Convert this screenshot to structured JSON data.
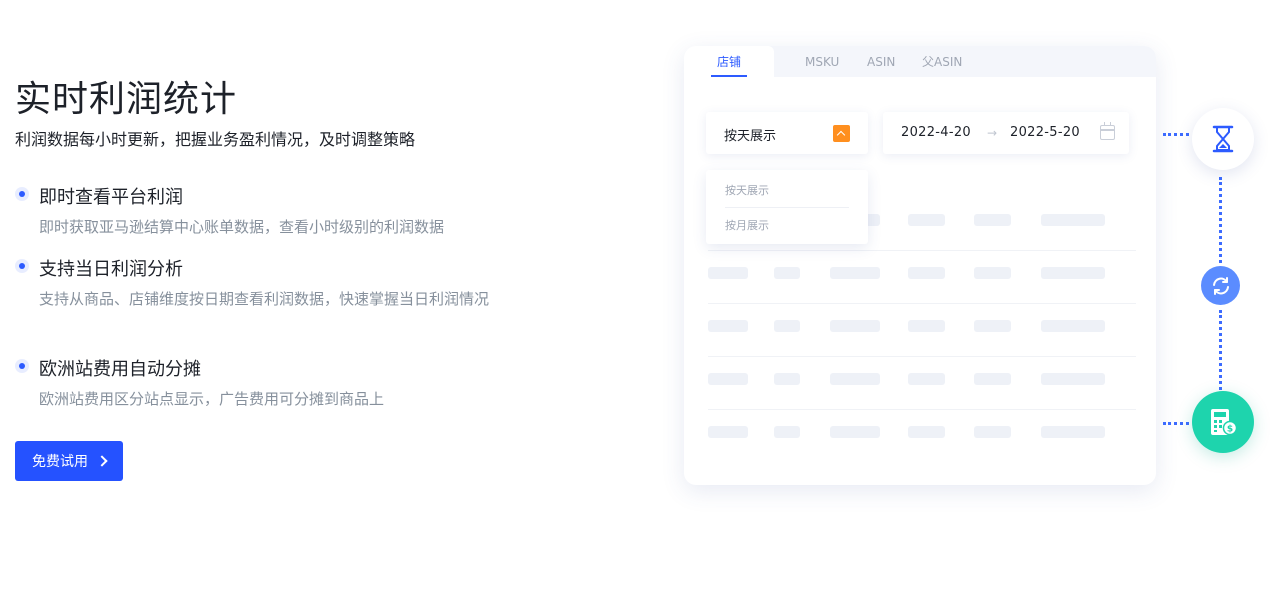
{
  "hero": {
    "title": "实时利润统计",
    "subtitle": "利润数据每小时更新，把握业务盈利情况，及时调整策略",
    "features": [
      {
        "title": "即时查看平台利润",
        "desc": "即时获取亚马逊结算中心账单数据，查看小时级别的利润数据"
      },
      {
        "title": "支持当日利润分析",
        "desc": "支持从商品、店铺维度按日期查看利润数据，快速掌握当日利润情况"
      },
      {
        "title": "欧洲站费用自动分摊",
        "desc": "欧洲站费用区分站点显示，广告费用可分摊到商品上"
      }
    ],
    "cta_label": "免费试用"
  },
  "card": {
    "tabs": [
      "店铺",
      "MSKU",
      "ASIN",
      "父ASIN"
    ],
    "active_tab": "店铺",
    "select": {
      "value": "按天展示",
      "options": [
        "按天展示",
        "按月展示"
      ]
    },
    "date_range": {
      "start": "2022-4-20",
      "end": "2022-5-20",
      "separator": "→"
    }
  },
  "icons": {
    "top": "hourglass-icon",
    "middle": "refresh-icon",
    "bottom": "calculator-dollar-icon"
  },
  "colors": {
    "accent": "#2552ff",
    "orange": "#ff8f1f",
    "teal": "#1ed4ad",
    "light_blue": "#5b8cff"
  }
}
